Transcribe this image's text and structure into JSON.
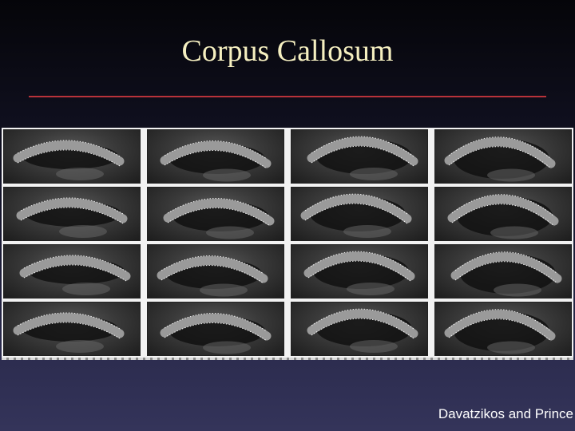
{
  "slide": {
    "title": "Corpus Callosum",
    "credit": "Davatzikos and Prince"
  },
  "mri_grid": {
    "rows": 4,
    "columns": 4,
    "panel_count": 16,
    "content": "sagittal brain MRI slices with dotted outline of the corpus callosum"
  },
  "colors": {
    "title_text": "#f5efc0",
    "rule": "#b8323a",
    "background_top": "#050509",
    "background_bottom": "#34345a",
    "credit_text": "#ffffff"
  }
}
